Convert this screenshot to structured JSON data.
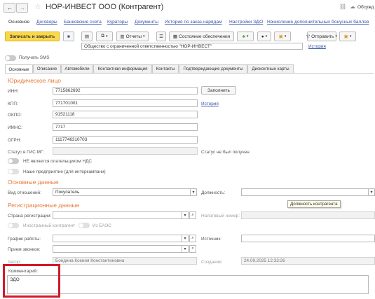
{
  "window": {
    "title": "НОР-ИНВЕСТ ООО (Контрагент)",
    "discuss_label": "Обсужд"
  },
  "nav_tabs": [
    "Основное",
    "Договоры",
    "Банковские счета",
    "Кураторы",
    "Документы",
    "История по заказ-нарядам",
    "Настройки ЭДО",
    "Начисление дополнительных бонусных баллов"
  ],
  "toolbar": {
    "save_close": "Записать и закрыть",
    "reports": "Отчеты",
    "status": "Состояние обеспечения",
    "send": "Отправить"
  },
  "top_field": {
    "value": "Общество с ограниченной ответственностью \"НОР-ИНВЕСТ\"",
    "history": "История"
  },
  "sms_label": "Получать SMS",
  "form_tabs": [
    "Основные",
    "Описание",
    "Автомобили",
    "Контактная информация",
    "Контакты",
    "Подтверждающие документы",
    "Дисконтные карты"
  ],
  "legal": {
    "section": "Юридическое лицо",
    "inn_label": "ИНН:",
    "inn": "7715862692",
    "fill_button": "Заполнить",
    "kpp_label": "КПП:",
    "kpp": "771701001",
    "history": "История",
    "okpo_label": "ОКПО:",
    "okpo": "91521118",
    "imns_label": "ИМНС:",
    "imns": "7717",
    "ogrn_label": "ОГРН:",
    "ogrn": "1117746310703",
    "gis_label": "Статус в ГИС МГ:",
    "gis_status": "Статус не был получен",
    "vat_label": "НЕ является плательщиком НДС",
    "ours_label": "Наше предприятие (для интеркампани)"
  },
  "main": {
    "section": "Основные данные",
    "relation_label": "Вид отношений:",
    "relation": "Покупатель",
    "position_label": "Должность:",
    "position": "",
    "tooltip": "Должность контрагента"
  },
  "reg": {
    "section": "Регистрационные данные",
    "country_label": "Страна регистрации:",
    "country": "",
    "tax_label": "Налоговый номер:",
    "tax": "",
    "foreign_label": "Иностранный контрагент",
    "eaes_label": "Из ЕАЭС",
    "schedule_label": "График работы:",
    "schedule": "",
    "source_label": "Источник:",
    "source": "",
    "calls_label": "Прием звонков:",
    "calls": "",
    "author_label": "Автор:",
    "author": "Бондина Ксения Константиновна",
    "created_label": "Создание:",
    "created": "24.09.2025 12:33:26"
  },
  "comment": {
    "label": "Комментарий:",
    "value": "ЭДО"
  }
}
